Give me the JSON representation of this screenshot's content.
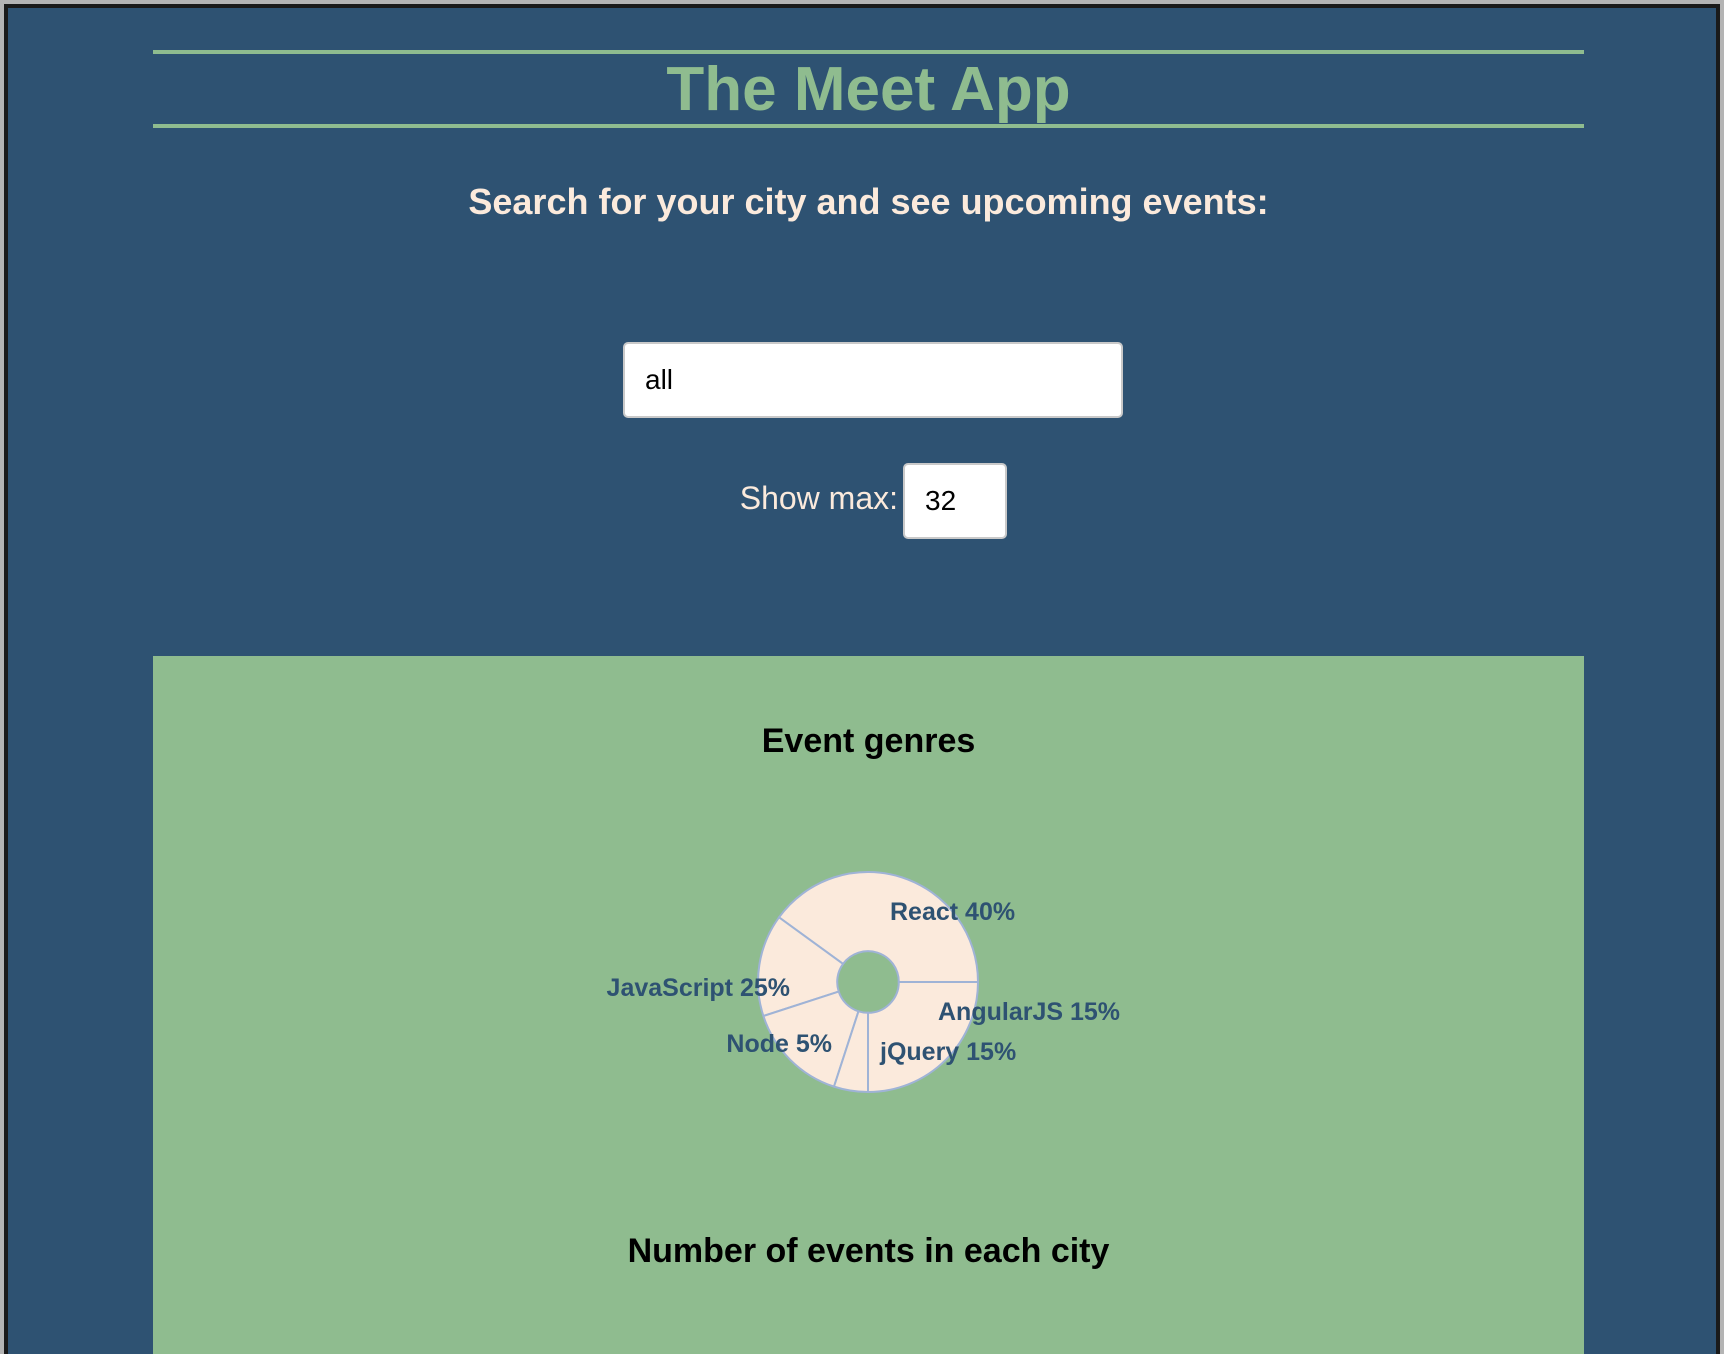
{
  "app": {
    "title": "The Meet App",
    "subtitle": "Search for your city and see upcoming events:"
  },
  "search": {
    "value": "all"
  },
  "number_of_events": {
    "label": "Show max:",
    "value": "32"
  },
  "colors": {
    "background": "#2e5272",
    "accent": "#8fbc8f",
    "text_light": "#fbeadc",
    "pie_fill": "#fbeadc",
    "pie_label": "#2e5272",
    "pie_stroke": "#9fb3d6"
  },
  "chart_data": [
    {
      "type": "pie",
      "title": "Event genres",
      "inner_radius_ratio": 0.28,
      "categories": [
        "React",
        "AngularJS",
        "jQuery",
        "Node",
        "JavaScript"
      ],
      "values": [
        40,
        15,
        15,
        5,
        25
      ],
      "labels": [
        "React 40%",
        "AngularJS 15%",
        "jQuery 15%",
        "Node 5%",
        "JavaScript 25%"
      ]
    },
    {
      "type": "bar",
      "title": "Number of events in each city",
      "categories": [],
      "values": []
    }
  ]
}
